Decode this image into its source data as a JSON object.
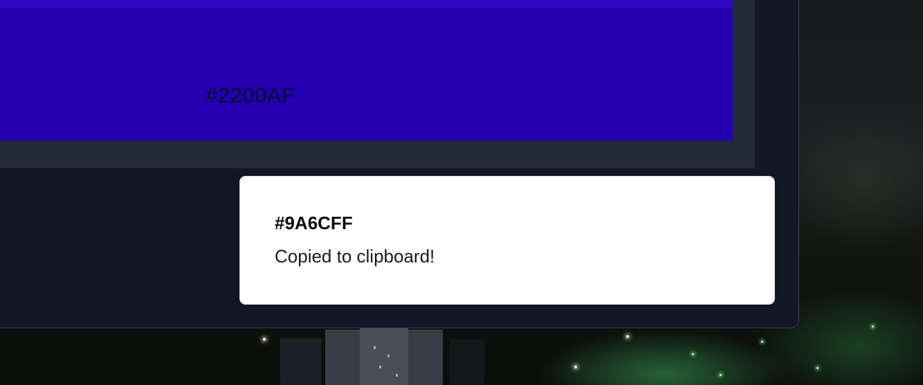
{
  "swatch": {
    "hex": "#2200AF",
    "color": "#2200af",
    "strip_color": "#3108c2"
  },
  "toast": {
    "title": "#9A6CFF",
    "message": "Copied to clipboard!"
  }
}
